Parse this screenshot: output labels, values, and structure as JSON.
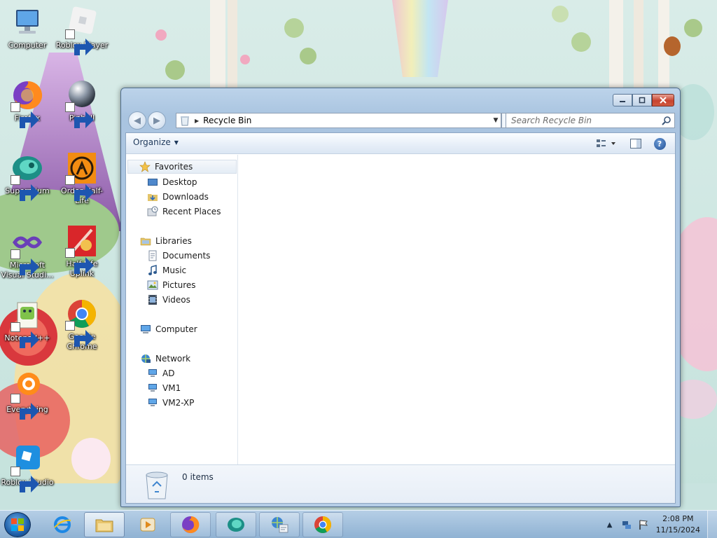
{
  "desktop": {
    "icons": [
      {
        "label": "Computer",
        "icon": "computer-icon"
      },
      {
        "label": "Roblox Player",
        "icon": "roblox-player-icon"
      },
      {
        "label": "Firefox",
        "icon": "firefox-icon"
      },
      {
        "label": "Pinball",
        "icon": "pinball-icon"
      },
      {
        "label": "Supermium",
        "icon": "supermium-icon"
      },
      {
        "label": "Order Half-Life",
        "icon": "half-life-icon"
      },
      {
        "label": "Microsoft Visual Studi...",
        "icon": "visual-studio-icon"
      },
      {
        "label": "Half-Life Uplink",
        "icon": "half-life-uplink-icon"
      },
      {
        "label": "Notepad++",
        "icon": "notepadpp-icon"
      },
      {
        "label": "Google Chrome",
        "icon": "chrome-icon"
      },
      {
        "label": "Everything",
        "icon": "everything-icon"
      },
      {
        "label": "Roblox Studio",
        "icon": "roblox-studio-icon"
      }
    ]
  },
  "window": {
    "title": "Recycle Bin",
    "address_path": "Recycle Bin",
    "search_placeholder": "Search Recycle Bin",
    "toolbar": {
      "organize_label": "Organize"
    },
    "nav": {
      "favorites": {
        "label": "Favorites",
        "items": [
          "Desktop",
          "Downloads",
          "Recent Places"
        ]
      },
      "libraries": {
        "label": "Libraries",
        "items": [
          "Documents",
          "Music",
          "Pictures",
          "Videos"
        ]
      },
      "computer": {
        "label": "Computer"
      },
      "network": {
        "label": "Network",
        "items": [
          "AD",
          "VM1",
          "VM2-XP"
        ]
      }
    },
    "details": {
      "item_count": "0 items"
    }
  },
  "taskbar": {
    "items": [
      {
        "name": "internet-explorer",
        "icon": "internet-explorer-icon"
      },
      {
        "name": "windows-explorer",
        "icon": "folder-icon",
        "active": true
      },
      {
        "name": "media-player",
        "icon": "media-player-icon"
      },
      {
        "name": "firefox",
        "icon": "firefox-icon"
      },
      {
        "name": "supermium",
        "icon": "supermium-icon"
      },
      {
        "name": "network-tool",
        "icon": "network-tool-icon"
      },
      {
        "name": "chrome",
        "icon": "chrome-icon"
      }
    ],
    "clock": {
      "time": "2:08 PM",
      "date": "11/15/2024"
    }
  },
  "colors": {
    "accent": "#2b5d98",
    "close_button": "#c7432f",
    "taskbar": "#9dbad8"
  }
}
